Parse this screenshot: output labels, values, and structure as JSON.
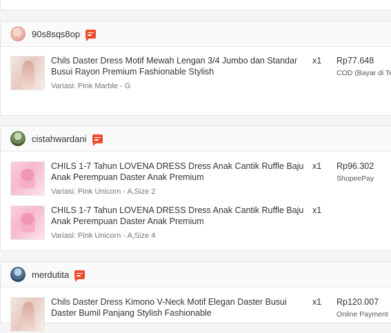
{
  "orders": [
    {
      "username": "90s8sqs8op",
      "items": [
        {
          "title": "Chils Daster Dress Motif Mewah Lengan 3/4 Jumbo dan Standar Busui Rayon Premium Fashionable Stylish",
          "variant": "Variasi: Pink Marble - G",
          "qty": "x1"
        }
      ],
      "price": "Rp77.648",
      "payment": "COD (Bayar di Te"
    },
    {
      "username": "cistahwardani",
      "items": [
        {
          "title": "CHILS 1-7 Tahun LOVENA DRESS Dress Anak Cantik Ruffle Baju Anak Perempuan Daster Anak Premium",
          "variant": "Variasi: Pink Unicorn - A,Size 2",
          "qty": "x1"
        },
        {
          "title": "CHILS 1-7 Tahun LOVENA DRESS Dress Anak Cantik Ruffle Baju Anak Perempuan Daster Anak Premium",
          "variant": "Variasi: Pink Unicorn - A,Size 4",
          "qty": "x1"
        }
      ],
      "price": "Rp96.302",
      "payment": "ShopeePay"
    },
    {
      "username": "merdutita",
      "items": [
        {
          "title": "Chils Daster Dress Kimono V-Neck Motif Elegan Daster Busui Daster Bumil Panjang Stylish Fashionable",
          "variant": "",
          "qty": "x1"
        }
      ],
      "price": "Rp120.007",
      "payment": "Online Payment"
    }
  ]
}
